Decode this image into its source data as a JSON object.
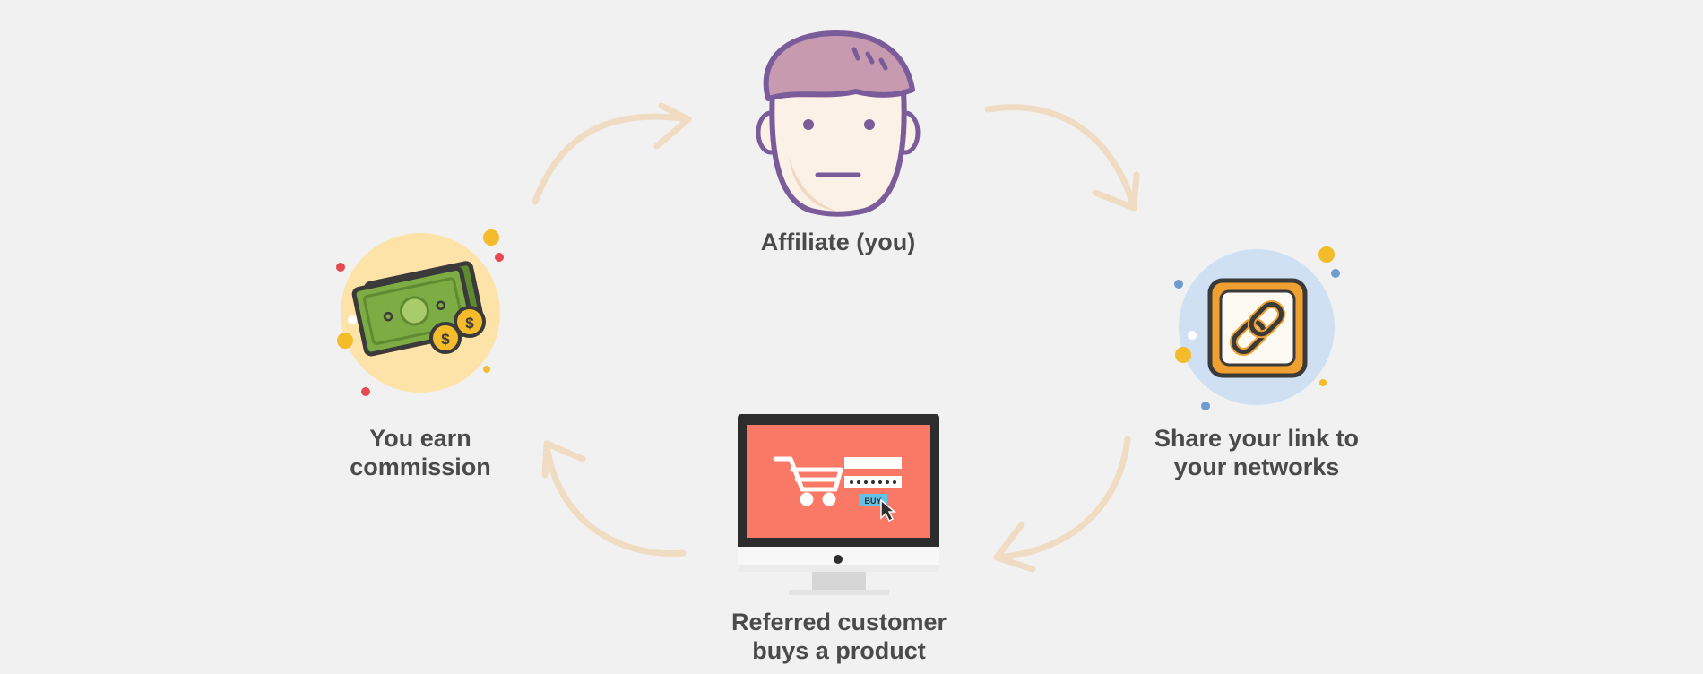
{
  "diagram": {
    "nodes": [
      {
        "id": "affiliate",
        "lines": [
          "Affiliate (you)"
        ],
        "icon": "affiliate-face-icon"
      },
      {
        "id": "share",
        "lines": [
          "Share your link to",
          "your networks"
        ],
        "icon": "chain-link-icon"
      },
      {
        "id": "customer",
        "lines": [
          "Referred customer",
          "buys a product"
        ],
        "icon": "monitor-shopping-cart-icon"
      },
      {
        "id": "commission",
        "lines": [
          "You earn",
          "commission"
        ],
        "icon": "money-bills-coins-icon"
      }
    ],
    "screen_button": "BUY",
    "coin_symbol": "$",
    "colors": {
      "background": "#f2f1f1",
      "arrow": "#f0dcc3",
      "text": "#4a4a4a",
      "hair": "#c79ab0",
      "outline": "#7a5c9a",
      "skin": "#fcf1e6",
      "money_circle": "#fde3a7",
      "bill": "#7cac43",
      "coin": "#f4bb2a",
      "link_circle": "#cfe0f3",
      "link_frame": "#f0a030",
      "screen": "#fa7866",
      "buy_button": "#63c2e8"
    }
  }
}
